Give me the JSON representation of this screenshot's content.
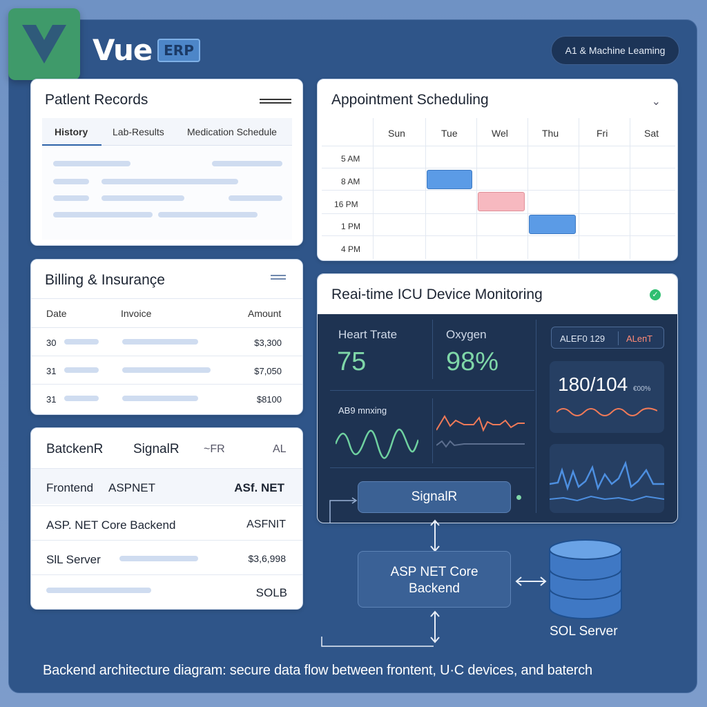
{
  "brand": {
    "name": "Vue",
    "badge": "ERP",
    "logo_icon": "vue-logo-icon"
  },
  "header": {
    "pill": "A1 & Machine Leaming"
  },
  "patient_records": {
    "title": "Patlent Records",
    "tabs": [
      "History",
      "Lab-Results",
      "Medication Schedule"
    ],
    "active_tab": "History"
  },
  "billing": {
    "title": "Billing & Insurançe",
    "columns": [
      "Date",
      "Invoice",
      "Amount"
    ],
    "rows": [
      {
        "date": "30",
        "amount": "$3,300"
      },
      {
        "date": "31",
        "amount": "$7,050"
      },
      {
        "date": "31",
        "amount": "$8100"
      }
    ]
  },
  "backend_card": {
    "headers": [
      "BatckenR",
      "SignalR",
      "~FR",
      "AL"
    ],
    "rows": [
      {
        "left": "Frontend",
        "mid": "ASPNET",
        "right": "ASf. NET"
      },
      {
        "left": "ASP. NET Core Backend",
        "right": "ASFNIT"
      },
      {
        "left": "SlL Server",
        "right": "$3,6,998"
      },
      {
        "right": "SOLB"
      }
    ]
  },
  "appointments": {
    "title": "Appointment Scheduling",
    "days": [
      "Sun",
      "Tue",
      "Wel",
      "Thu",
      "Fri",
      "Sat"
    ],
    "times": [
      "5 AM",
      "8 AM",
      "16 PM",
      "1 PM",
      "4 PM"
    ],
    "events": [
      {
        "day": "Tue",
        "time": "8 AM",
        "color": "#5b9be6"
      },
      {
        "day": "Wel",
        "time": "16 PM",
        "color": "#f7b9c0"
      },
      {
        "day": "Thu",
        "time": "1 PM",
        "color": "#5b9be6"
      }
    ]
  },
  "icu": {
    "title": "Reai-time ICU Device Monitoring",
    "heart_label": "Heart Trate",
    "heart_value": "75",
    "oxygen_label": "Oxygen",
    "oxygen_value": "98%",
    "alert_id": "ALEF0 129",
    "alert_status": "ALeпT",
    "bp_value": "180/104",
    "bp_unit": "€00%",
    "wave_label": "AB9 mnxing",
    "signalr": "SignalR",
    "status_icon": "check-circle-icon"
  },
  "architecture": {
    "core_backend": [
      "ASP NET Core",
      "Backend"
    ],
    "sql_label": "SOL Server",
    "caption": "Backend architecture diagram: secure data flow between frontent, U·C devices, and baterch"
  },
  "colors": {
    "background": "#2f5589",
    "accent_green": "#3f9a6a",
    "vital_green": "#7fd7a8",
    "alert_red": "#ff8a76",
    "wave_blue": "#4d8fe0"
  }
}
